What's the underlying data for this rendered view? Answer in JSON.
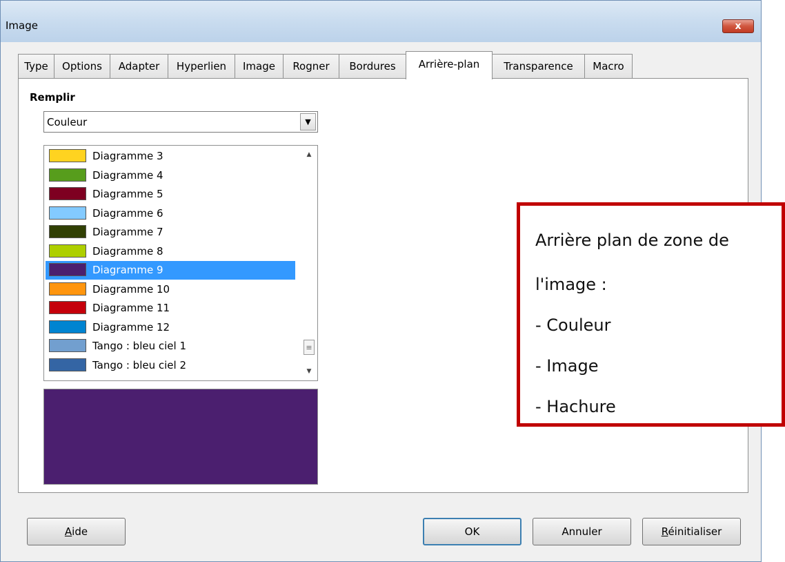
{
  "window": {
    "title": "Image",
    "close_label": "x"
  },
  "tabs": [
    {
      "label": "Type"
    },
    {
      "label": "Options"
    },
    {
      "label": "Adapter"
    },
    {
      "label": "Hyperlien"
    },
    {
      "label": "Image"
    },
    {
      "label": "Rogner"
    },
    {
      "label": "Bordures"
    },
    {
      "label": "Arrière-plan",
      "active": true
    },
    {
      "label": "Transparence"
    },
    {
      "label": "Macro"
    }
  ],
  "fill": {
    "section_label": "Remplir",
    "type_value": "Couleur",
    "colors": [
      {
        "label": "Diagramme 3",
        "color": "#ffd320"
      },
      {
        "label": "Diagramme 4",
        "color": "#579d1c"
      },
      {
        "label": "Diagramme 5",
        "color": "#7e0021"
      },
      {
        "label": "Diagramme 6",
        "color": "#83caff"
      },
      {
        "label": "Diagramme 7",
        "color": "#314004"
      },
      {
        "label": "Diagramme 8",
        "color": "#aecf00"
      },
      {
        "label": "Diagramme 9",
        "color": "#4b1f6f",
        "selected": true
      },
      {
        "label": "Diagramme 10",
        "color": "#ff950e"
      },
      {
        "label": "Diagramme 11",
        "color": "#c5000b"
      },
      {
        "label": "Diagramme 12",
        "color": "#0084d1"
      },
      {
        "label": "Tango : bleu ciel 1",
        "color": "#729fcf"
      },
      {
        "label": "Tango : bleu ciel 2",
        "color": "#3465a4"
      }
    ],
    "preview_color": "#4b1f6f"
  },
  "buttons": {
    "help": "Aide",
    "ok": "OK",
    "cancel": "Annuler",
    "reset": "Réinitialiser"
  },
  "callout": {
    "lines": [
      "Arrière plan de zone de",
      "l'image  :",
      "- Couleur",
      "- Image",
      "- Hachure"
    ]
  }
}
